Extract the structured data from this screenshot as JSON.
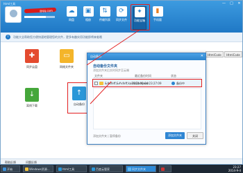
{
  "window": {
    "title": "html工具",
    "account_suffix": "@qq.com",
    "quota_percent": 70,
    "controls": [
      "—",
      "□",
      "✕"
    ]
  },
  "toolbar": [
    {
      "label": "网盘",
      "icon": "cloud-icon"
    },
    {
      "label": "相册",
      "icon": "photo-icon"
    },
    {
      "label": "传输列表",
      "icon": "transfer-icon"
    },
    {
      "label": "同步文件",
      "icon": "sync-icon"
    },
    {
      "label": "功能宝箱",
      "icon": "toolbox-icon"
    },
    {
      "label": "手机版",
      "icon": "phone-icon"
    }
  ],
  "notice": {
    "text": "功能大全帮助您方便快速地管理您的文件，更多有趣实用功能即将来临哦"
  },
  "tiles": [
    {
      "label": "同步云盘",
      "icon": "cloud-sync-icon",
      "color": "#e44b2f"
    },
    {
      "label": "网络文件夹",
      "icon": "folder-icon",
      "color": "#f4b52a"
    },
    {
      "label": "离线下载",
      "icon": "download-icon",
      "color": "#45a73a"
    },
    {
      "label": "自动备份",
      "icon": "upload-icon",
      "color": "#2a97d8"
    }
  ],
  "code_tabs": [
    "HtmlCode",
    "HtmlCode"
  ],
  "dialog": {
    "title": "自动备份",
    "close": "✕",
    "heading": "自动备份文件夹",
    "subtitle": "添加文件夹后实时同步至云端",
    "columns": {
      "name": "文件夹",
      "time": "最近备份时间",
      "status": "状态"
    },
    "row": {
      "name": "&#xfeff;&#xfeff;kairlis2ompuor",
      "time": "2014-09-04 23:27:09",
      "status": "备份中"
    },
    "footer": "添加文件夹 | 暂停备份",
    "start_button": "添加文件夹",
    "cancel_button": "关闭"
  },
  "status": {
    "left": "帮助反馈",
    "mid": "问题反馈"
  },
  "taskbar": {
    "tasks": [
      {
        "label": "开始",
        "color": "#3d8fd6"
      },
      {
        "label": "Windows资源...",
        "color": "#f2c23c"
      },
      {
        "label": "html工具",
        "color": "#2a97d8"
      },
      {
        "label": "百度云管家",
        "color": "#2a97d8"
      },
      {
        "label": "同步文件夹",
        "color": "#5fb8f0"
      },
      {
        "label": "",
        "color": "#c33"
      }
    ],
    "clock_time": "23:27",
    "clock_date": "2014-9-4"
  }
}
